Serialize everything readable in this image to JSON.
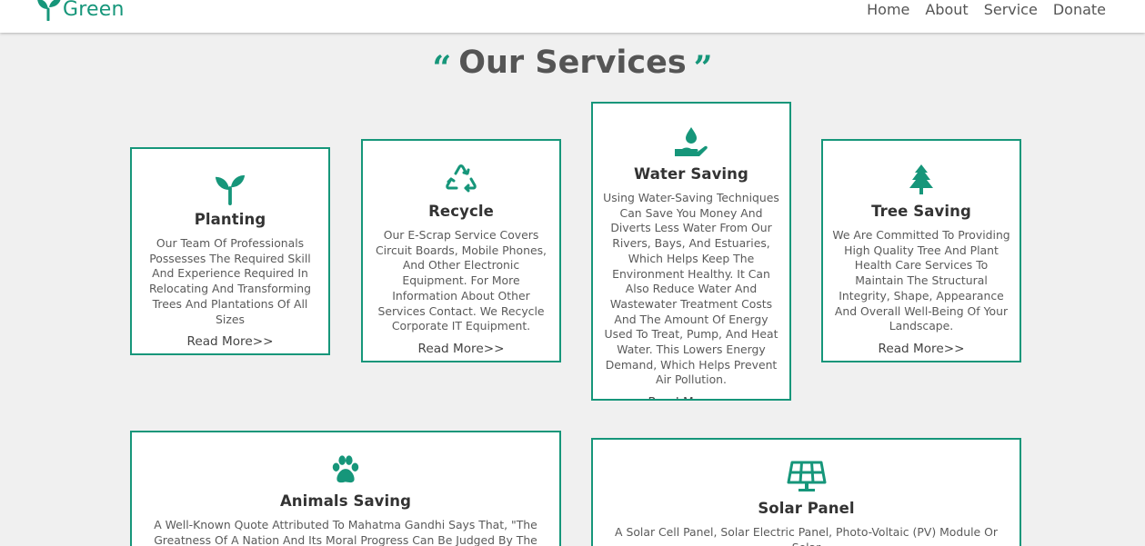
{
  "brand": {
    "name": "Green",
    "color": "#16967a"
  },
  "nav": {
    "items": [
      {
        "label": "Home"
      },
      {
        "label": "About"
      },
      {
        "label": "Service"
      },
      {
        "label": "Donate"
      }
    ]
  },
  "services": {
    "title": "Our Services",
    "open_quote": "“",
    "close_quote": "”",
    "read_more": "Read More>>",
    "cards": [
      {
        "icon": "seedling-icon",
        "title": "Planting",
        "text": "Our Team Of Professionals Possesses The Required Skill And Experience Required In Relocating And Transforming Trees And Plantations Of All Sizes"
      },
      {
        "icon": "recycle-icon",
        "title": "Recycle",
        "text": "Our E-Scrap Service Covers Circuit Boards, Mobile Phones, And Other Electronic Equipment. For More Information About Other Services Contact. We Recycle Corporate IT Equipment."
      },
      {
        "icon": "water-drop-hand-icon",
        "title": "Water Saving",
        "text": "Using Water-Saving Techniques Can Save You Money And Diverts Less Water From Our Rivers, Bays, And Estuaries, Which Helps Keep The Environment Healthy. It Can Also Reduce Water And Wastewater Treatment Costs And The Amount Of Energy Used To Treat, Pump, And Heat Water. This Lowers Energy Demand, Which Helps Prevent Air Pollution."
      },
      {
        "icon": "tree-icon",
        "title": "Tree Saving",
        "text": "We Are Committed To Providing High Quality Tree And Plant Health Care Services To Maintain The Structural Integrity, Shape, Appearance And Overall Well-Being Of Your Landscape."
      },
      {
        "icon": "paw-icon",
        "title": "Animals Saving",
        "text": "A Well-Known Quote Attributed To Mahatma Gandhi Says That, \"The Greatness Of A Nation And Its Moral Progress Can Be Judged By The Way Its"
      },
      {
        "icon": "solar-panel-icon",
        "title": "Solar Panel",
        "text": "A Solar Cell Panel, Solar Electric Panel, Photo-Voltaic (PV) Module Or Solar"
      }
    ]
  }
}
